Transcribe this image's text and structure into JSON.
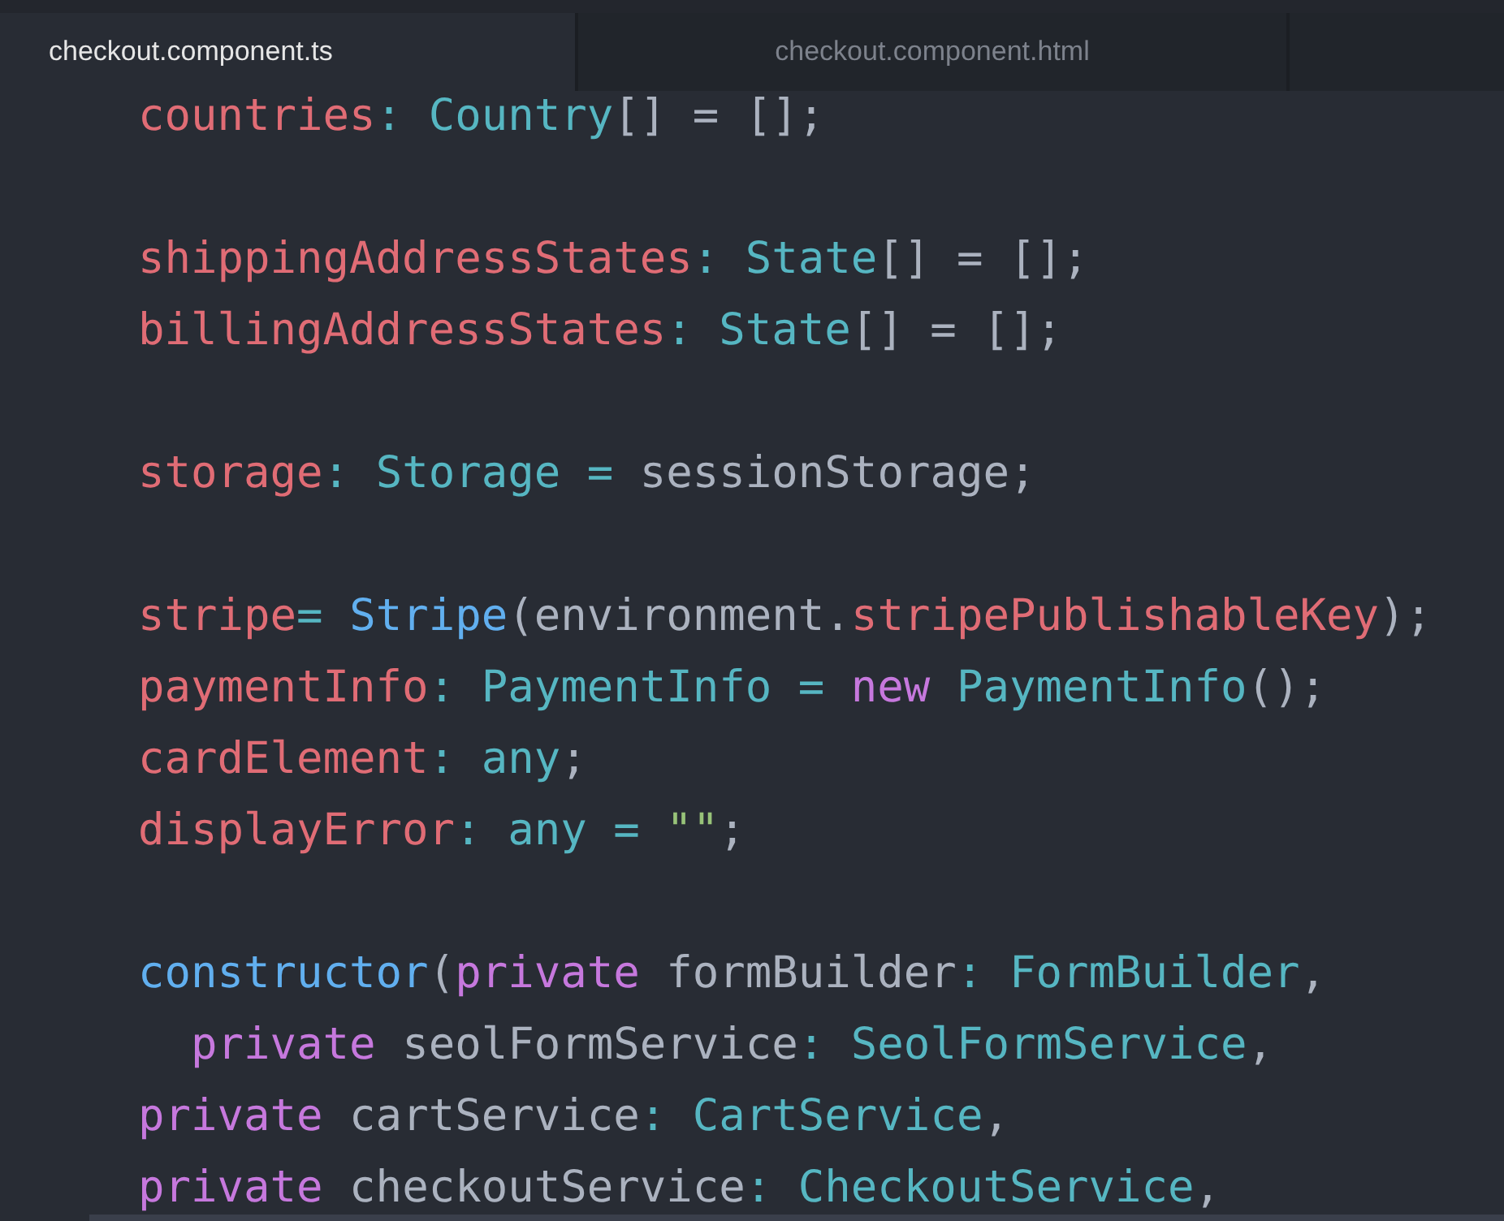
{
  "tabs": [
    {
      "label": "checkout.component.ts",
      "selected": true
    },
    {
      "label": "checkout.component.html",
      "selected": false
    }
  ],
  "code": {
    "blocks": [
      {
        "lines": [
          {
            "tokens": [
              {
                "kind": "prop",
                "text": "countries"
              },
              {
                "kind": "op",
                "text": ": "
              },
              {
                "kind": "type",
                "text": "Country"
              },
              {
                "kind": "plain",
                "text": "[] = [];"
              }
            ]
          }
        ]
      },
      {
        "lines": [
          {
            "tokens": [
              {
                "kind": "prop",
                "text": "shippingAddressStates"
              },
              {
                "kind": "op",
                "text": ": "
              },
              {
                "kind": "type",
                "text": "State"
              },
              {
                "kind": "plain",
                "text": "[] = [];"
              }
            ]
          },
          {
            "tokens": [
              {
                "kind": "prop",
                "text": "billingAddressStates"
              },
              {
                "kind": "op",
                "text": ": "
              },
              {
                "kind": "type",
                "text": "State"
              },
              {
                "kind": "plain",
                "text": "[] = [];"
              }
            ]
          }
        ]
      },
      {
        "lines": [
          {
            "tokens": [
              {
                "kind": "prop",
                "text": "storage"
              },
              {
                "kind": "op",
                "text": ": "
              },
              {
                "kind": "type",
                "text": "Storage"
              },
              {
                "kind": "op",
                "text": " = "
              },
              {
                "kind": "plain",
                "text": "sessionStorage;"
              }
            ]
          }
        ]
      },
      {
        "lines": [
          {
            "tokens": [
              {
                "kind": "prop",
                "text": "stripe"
              },
              {
                "kind": "op",
                "text": "= "
              },
              {
                "kind": "func",
                "text": "Stripe"
              },
              {
                "kind": "plain",
                "text": "(environment."
              },
              {
                "kind": "prop",
                "text": "stripePublishableKey"
              },
              {
                "kind": "plain",
                "text": ");"
              }
            ]
          },
          {
            "tokens": [
              {
                "kind": "prop",
                "text": "paymentInfo"
              },
              {
                "kind": "op",
                "text": ": "
              },
              {
                "kind": "type",
                "text": "PaymentInfo"
              },
              {
                "kind": "op",
                "text": " = "
              },
              {
                "kind": "keyword",
                "text": "new"
              },
              {
                "kind": "type",
                "text": " PaymentInfo"
              },
              {
                "kind": "plain",
                "text": "();"
              }
            ]
          },
          {
            "tokens": [
              {
                "kind": "prop",
                "text": "cardElement"
              },
              {
                "kind": "op",
                "text": ": any"
              },
              {
                "kind": "plain",
                "text": ";"
              }
            ]
          },
          {
            "tokens": [
              {
                "kind": "prop",
                "text": "displayError"
              },
              {
                "kind": "op",
                "text": ": any = "
              },
              {
                "kind": "string",
                "text": "\"\""
              },
              {
                "kind": "plain",
                "text": ";"
              }
            ]
          }
        ]
      },
      {
        "lines": [
          {
            "tokens": [
              {
                "kind": "func",
                "text": "constructor"
              },
              {
                "kind": "plain",
                "text": "("
              },
              {
                "kind": "keyword",
                "text": "private"
              },
              {
                "kind": "plain",
                "text": " formBuilder"
              },
              {
                "kind": "op",
                "text": ": "
              },
              {
                "kind": "type",
                "text": "FormBuilder"
              },
              {
                "kind": "plain",
                "text": ","
              }
            ]
          },
          {
            "tokens": [
              {
                "kind": "keyword",
                "text": "  private"
              },
              {
                "kind": "plain",
                "text": " seolFormService"
              },
              {
                "kind": "op",
                "text": ": "
              },
              {
                "kind": "type",
                "text": "SeolFormService"
              },
              {
                "kind": "plain",
                "text": ","
              }
            ]
          },
          {
            "tokens": [
              {
                "kind": "keyword",
                "text": "private"
              },
              {
                "kind": "plain",
                "text": " cartService"
              },
              {
                "kind": "op",
                "text": ": "
              },
              {
                "kind": "type",
                "text": "CartService"
              },
              {
                "kind": "plain",
                "text": ","
              }
            ]
          },
          {
            "tokens": [
              {
                "kind": "keyword",
                "text": "private"
              },
              {
                "kind": "plain",
                "text": " checkoutService"
              },
              {
                "kind": "op",
                "text": ": "
              },
              {
                "kind": "type",
                "text": "CheckoutService"
              },
              {
                "kind": "plain",
                "text": ","
              }
            ]
          }
        ]
      }
    ]
  }
}
